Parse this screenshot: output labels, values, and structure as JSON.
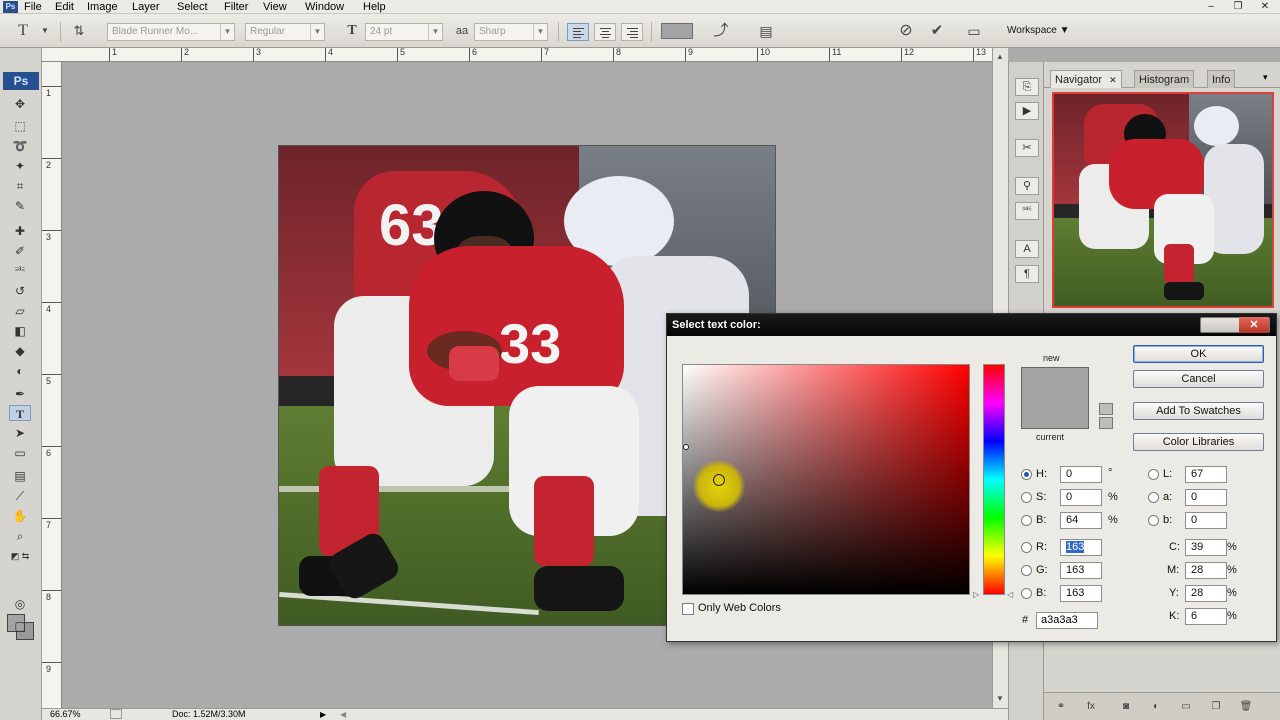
{
  "app": {
    "logo": "Ps",
    "menu": [
      "File",
      "Edit",
      "Image",
      "Layer",
      "Select",
      "Filter",
      "View",
      "Window",
      "Help"
    ],
    "window_controls": {
      "minimize": "–",
      "restore": "❐",
      "close": "✕"
    }
  },
  "options_bar": {
    "font_family": "Blade Runner Mo...",
    "font_style": "Regular",
    "font_size": "24 pt",
    "aa_label": "aa",
    "antialias": "Sharp",
    "text_color": "#a3a3a3",
    "workspace_label": "Workspace ▼"
  },
  "tools": {
    "active": "text-tool",
    "foreground_color": "#a3a3a3",
    "background_color": "#9a9a9a"
  },
  "rulers": {
    "horizontal_ticks": [
      "1",
      "2",
      "3",
      "4",
      "5",
      "6",
      "7",
      "8",
      "9",
      "10",
      "11",
      "12",
      "13"
    ],
    "vertical_ticks": [
      "1",
      "2",
      "3",
      "4",
      "5",
      "6",
      "7",
      "8",
      "9"
    ]
  },
  "status_bar": {
    "zoom": "66.67%",
    "doc_info": "Doc: 1.52M/3.30M"
  },
  "navigator": {
    "tabs": [
      "Navigator",
      "Histogram",
      "Info"
    ],
    "active_tab": "Navigator",
    "view_box_color": "#e03c3c"
  },
  "color_dialog": {
    "title": "Select text color:",
    "close_label": "✕",
    "new_label": "new",
    "current_label": "current",
    "new_color": "#a3a3a3",
    "current_color": "#a3a3a3",
    "buttons": {
      "ok": "OK",
      "cancel": "Cancel",
      "add_to_swatches": "Add To Swatches",
      "color_libraries": "Color Libraries"
    },
    "hsb": {
      "h": "0",
      "h_unit": "°",
      "s": "0",
      "s_unit": "%",
      "b": "64",
      "b_unit": "%",
      "selected": "H"
    },
    "rgb": {
      "r": "163",
      "g": "163",
      "b": "163"
    },
    "lab": {
      "l": "67",
      "a": "0",
      "b": "0"
    },
    "cmyk": {
      "c": "39",
      "m": "28",
      "y": "28",
      "k": "6",
      "unit": "%"
    },
    "labels": {
      "h": "H:",
      "s": "S:",
      "b": "B:",
      "r": "R:",
      "g": "G:",
      "b2": "B:",
      "l": "L:",
      "a": "a:",
      "b3": "b:",
      "c": "C:",
      "m": "M:",
      "y": "Y:",
      "k": "K:",
      "hex_prefix": "#"
    },
    "hex": "a3a3a3",
    "only_web_colors": "Only Web Colors"
  }
}
